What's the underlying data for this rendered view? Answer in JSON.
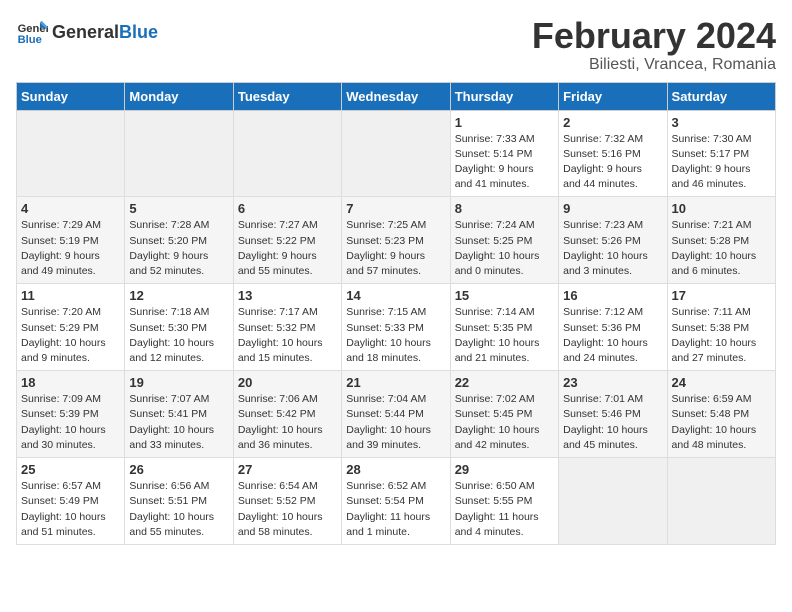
{
  "header": {
    "logo_general": "General",
    "logo_blue": "Blue",
    "title": "February 2024",
    "subtitle": "Biliesti, Vrancea, Romania"
  },
  "weekdays": [
    "Sunday",
    "Monday",
    "Tuesday",
    "Wednesday",
    "Thursday",
    "Friday",
    "Saturday"
  ],
  "weeks": [
    [
      {
        "day": "",
        "info": ""
      },
      {
        "day": "",
        "info": ""
      },
      {
        "day": "",
        "info": ""
      },
      {
        "day": "",
        "info": ""
      },
      {
        "day": "1",
        "info": "Sunrise: 7:33 AM\nSunset: 5:14 PM\nDaylight: 9 hours\nand 41 minutes."
      },
      {
        "day": "2",
        "info": "Sunrise: 7:32 AM\nSunset: 5:16 PM\nDaylight: 9 hours\nand 44 minutes."
      },
      {
        "day": "3",
        "info": "Sunrise: 7:30 AM\nSunset: 5:17 PM\nDaylight: 9 hours\nand 46 minutes."
      }
    ],
    [
      {
        "day": "4",
        "info": "Sunrise: 7:29 AM\nSunset: 5:19 PM\nDaylight: 9 hours\nand 49 minutes."
      },
      {
        "day": "5",
        "info": "Sunrise: 7:28 AM\nSunset: 5:20 PM\nDaylight: 9 hours\nand 52 minutes."
      },
      {
        "day": "6",
        "info": "Sunrise: 7:27 AM\nSunset: 5:22 PM\nDaylight: 9 hours\nand 55 minutes."
      },
      {
        "day": "7",
        "info": "Sunrise: 7:25 AM\nSunset: 5:23 PM\nDaylight: 9 hours\nand 57 minutes."
      },
      {
        "day": "8",
        "info": "Sunrise: 7:24 AM\nSunset: 5:25 PM\nDaylight: 10 hours\nand 0 minutes."
      },
      {
        "day": "9",
        "info": "Sunrise: 7:23 AM\nSunset: 5:26 PM\nDaylight: 10 hours\nand 3 minutes."
      },
      {
        "day": "10",
        "info": "Sunrise: 7:21 AM\nSunset: 5:28 PM\nDaylight: 10 hours\nand 6 minutes."
      }
    ],
    [
      {
        "day": "11",
        "info": "Sunrise: 7:20 AM\nSunset: 5:29 PM\nDaylight: 10 hours\nand 9 minutes."
      },
      {
        "day": "12",
        "info": "Sunrise: 7:18 AM\nSunset: 5:30 PM\nDaylight: 10 hours\nand 12 minutes."
      },
      {
        "day": "13",
        "info": "Sunrise: 7:17 AM\nSunset: 5:32 PM\nDaylight: 10 hours\nand 15 minutes."
      },
      {
        "day": "14",
        "info": "Sunrise: 7:15 AM\nSunset: 5:33 PM\nDaylight: 10 hours\nand 18 minutes."
      },
      {
        "day": "15",
        "info": "Sunrise: 7:14 AM\nSunset: 5:35 PM\nDaylight: 10 hours\nand 21 minutes."
      },
      {
        "day": "16",
        "info": "Sunrise: 7:12 AM\nSunset: 5:36 PM\nDaylight: 10 hours\nand 24 minutes."
      },
      {
        "day": "17",
        "info": "Sunrise: 7:11 AM\nSunset: 5:38 PM\nDaylight: 10 hours\nand 27 minutes."
      }
    ],
    [
      {
        "day": "18",
        "info": "Sunrise: 7:09 AM\nSunset: 5:39 PM\nDaylight: 10 hours\nand 30 minutes."
      },
      {
        "day": "19",
        "info": "Sunrise: 7:07 AM\nSunset: 5:41 PM\nDaylight: 10 hours\nand 33 minutes."
      },
      {
        "day": "20",
        "info": "Sunrise: 7:06 AM\nSunset: 5:42 PM\nDaylight: 10 hours\nand 36 minutes."
      },
      {
        "day": "21",
        "info": "Sunrise: 7:04 AM\nSunset: 5:44 PM\nDaylight: 10 hours\nand 39 minutes."
      },
      {
        "day": "22",
        "info": "Sunrise: 7:02 AM\nSunset: 5:45 PM\nDaylight: 10 hours\nand 42 minutes."
      },
      {
        "day": "23",
        "info": "Sunrise: 7:01 AM\nSunset: 5:46 PM\nDaylight: 10 hours\nand 45 minutes."
      },
      {
        "day": "24",
        "info": "Sunrise: 6:59 AM\nSunset: 5:48 PM\nDaylight: 10 hours\nand 48 minutes."
      }
    ],
    [
      {
        "day": "25",
        "info": "Sunrise: 6:57 AM\nSunset: 5:49 PM\nDaylight: 10 hours\nand 51 minutes."
      },
      {
        "day": "26",
        "info": "Sunrise: 6:56 AM\nSunset: 5:51 PM\nDaylight: 10 hours\nand 55 minutes."
      },
      {
        "day": "27",
        "info": "Sunrise: 6:54 AM\nSunset: 5:52 PM\nDaylight: 10 hours\nand 58 minutes."
      },
      {
        "day": "28",
        "info": "Sunrise: 6:52 AM\nSunset: 5:54 PM\nDaylight: 11 hours\nand 1 minute."
      },
      {
        "day": "29",
        "info": "Sunrise: 6:50 AM\nSunset: 5:55 PM\nDaylight: 11 hours\nand 4 minutes."
      },
      {
        "day": "",
        "info": ""
      },
      {
        "day": "",
        "info": ""
      }
    ]
  ]
}
